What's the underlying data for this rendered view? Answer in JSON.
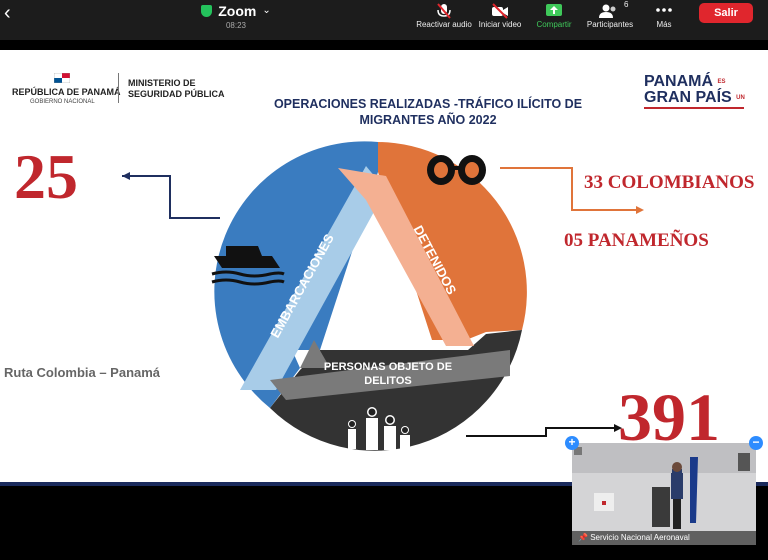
{
  "app": {
    "title": "Zoom",
    "timer": "08:23",
    "back_icon": "chevron-left-icon",
    "security_icon": "shield-check-icon"
  },
  "toolbar": {
    "audio_label": "Reactivar audio",
    "video_label": "Iniciar video",
    "share_label": "Compartir",
    "participants_label": "Participantes",
    "participants_count": "6",
    "more_label": "Más",
    "leave_label": "Salir"
  },
  "slide": {
    "ministry": {
      "country": "REPÚBLICA DE PANAMÁ",
      "gov": "GOBIERNO NACIONAL",
      "ministry_line1": "MINISTERIO DE",
      "ministry_line2": "SEGURIDAD PÚBLICA"
    },
    "title_line1": "OPERACIONES REALIZADAS -TRÁFICO ILÍCITO DE",
    "title_line2": "MIGRANTES AÑO 2022",
    "brand": {
      "line1": "PANAMÁ",
      "small1": "ES",
      "small2": "UN",
      "line2": "GRAN PAÍS"
    },
    "number_boats": "25",
    "detained_colombians": "33 COLOMBIANOS",
    "detained_panamanians": "05 PANAMEÑOS",
    "route": "Ruta Colombia – Panamá",
    "number_persons": "391",
    "cycle_labels": {
      "embarcaciones": "EMBARCACIONES",
      "detenidos": "DETENIDOS",
      "personas_line1": "PERSONAS OBJETO DE",
      "personas_line2": "DELITOS"
    },
    "colors": {
      "blue": "#3a7cc0",
      "orange": "#e0743a",
      "dark": "#333333",
      "red": "#c0272d",
      "navy": "#1f2f5f"
    }
  },
  "video_tile": {
    "name": "Servicio Nacional Aeronaval",
    "pin_icon": "pin-icon"
  }
}
